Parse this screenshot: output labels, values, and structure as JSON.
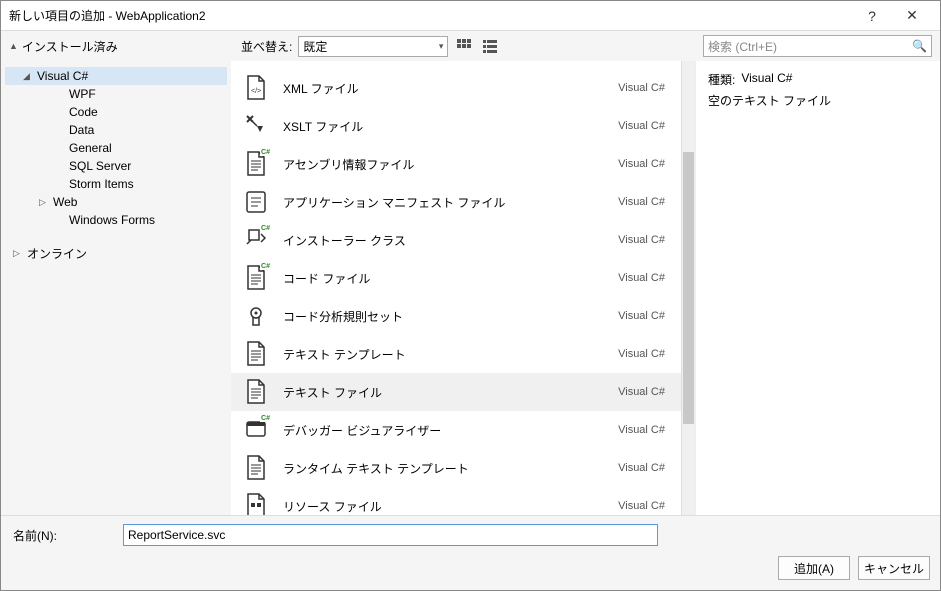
{
  "titlebar": {
    "title": "新しい項目の追加 - WebApplication2"
  },
  "topbar": {
    "installed_label": "インストール済み",
    "sort_label": "並べ替え:",
    "sort_value": "既定",
    "search_placeholder": "検索 (Ctrl+E)"
  },
  "sidebar": {
    "root": "Visual C#",
    "items": [
      {
        "label": "WPF"
      },
      {
        "label": "Code"
      },
      {
        "label": "Data"
      },
      {
        "label": "General"
      },
      {
        "label": "SQL Server"
      },
      {
        "label": "Storm Items"
      },
      {
        "label": "Web",
        "expandable": true
      },
      {
        "label": "Windows Forms"
      }
    ],
    "online": "オンライン"
  },
  "items": [
    {
      "name": "XML ファイル",
      "lang": "Visual C#",
      "icon": "xml"
    },
    {
      "name": "XSLT ファイル",
      "lang": "Visual C#",
      "icon": "xslt"
    },
    {
      "name": "アセンブリ情報ファイル",
      "lang": "Visual C#",
      "icon": "assembly"
    },
    {
      "name": "アプリケーション マニフェスト ファイル",
      "lang": "Visual C#",
      "icon": "manifest"
    },
    {
      "name": "インストーラー クラス",
      "lang": "Visual C#",
      "icon": "installer"
    },
    {
      "name": "コード ファイル",
      "lang": "Visual C#",
      "icon": "code"
    },
    {
      "name": "コード分析規則セット",
      "lang": "Visual C#",
      "icon": "ruleset"
    },
    {
      "name": "テキスト テンプレート",
      "lang": "Visual C#",
      "icon": "text"
    },
    {
      "name": "テキスト ファイル",
      "lang": "Visual C#",
      "icon": "text",
      "selected": true
    },
    {
      "name": "デバッガー ビジュアライザー",
      "lang": "Visual C#",
      "icon": "debugger"
    },
    {
      "name": "ランタイム テキスト テンプレート",
      "lang": "Visual C#",
      "icon": "text"
    },
    {
      "name": "リソース ファイル",
      "lang": "Visual C#",
      "icon": "resource"
    }
  ],
  "details": {
    "type_label": "種類:",
    "type_value": "Visual C#",
    "description": "空のテキスト ファイル"
  },
  "footer": {
    "name_label": "名前(N):",
    "name_value": "ReportService.svc",
    "add_button": "追加(A)",
    "cancel_button": "キャンセル"
  }
}
